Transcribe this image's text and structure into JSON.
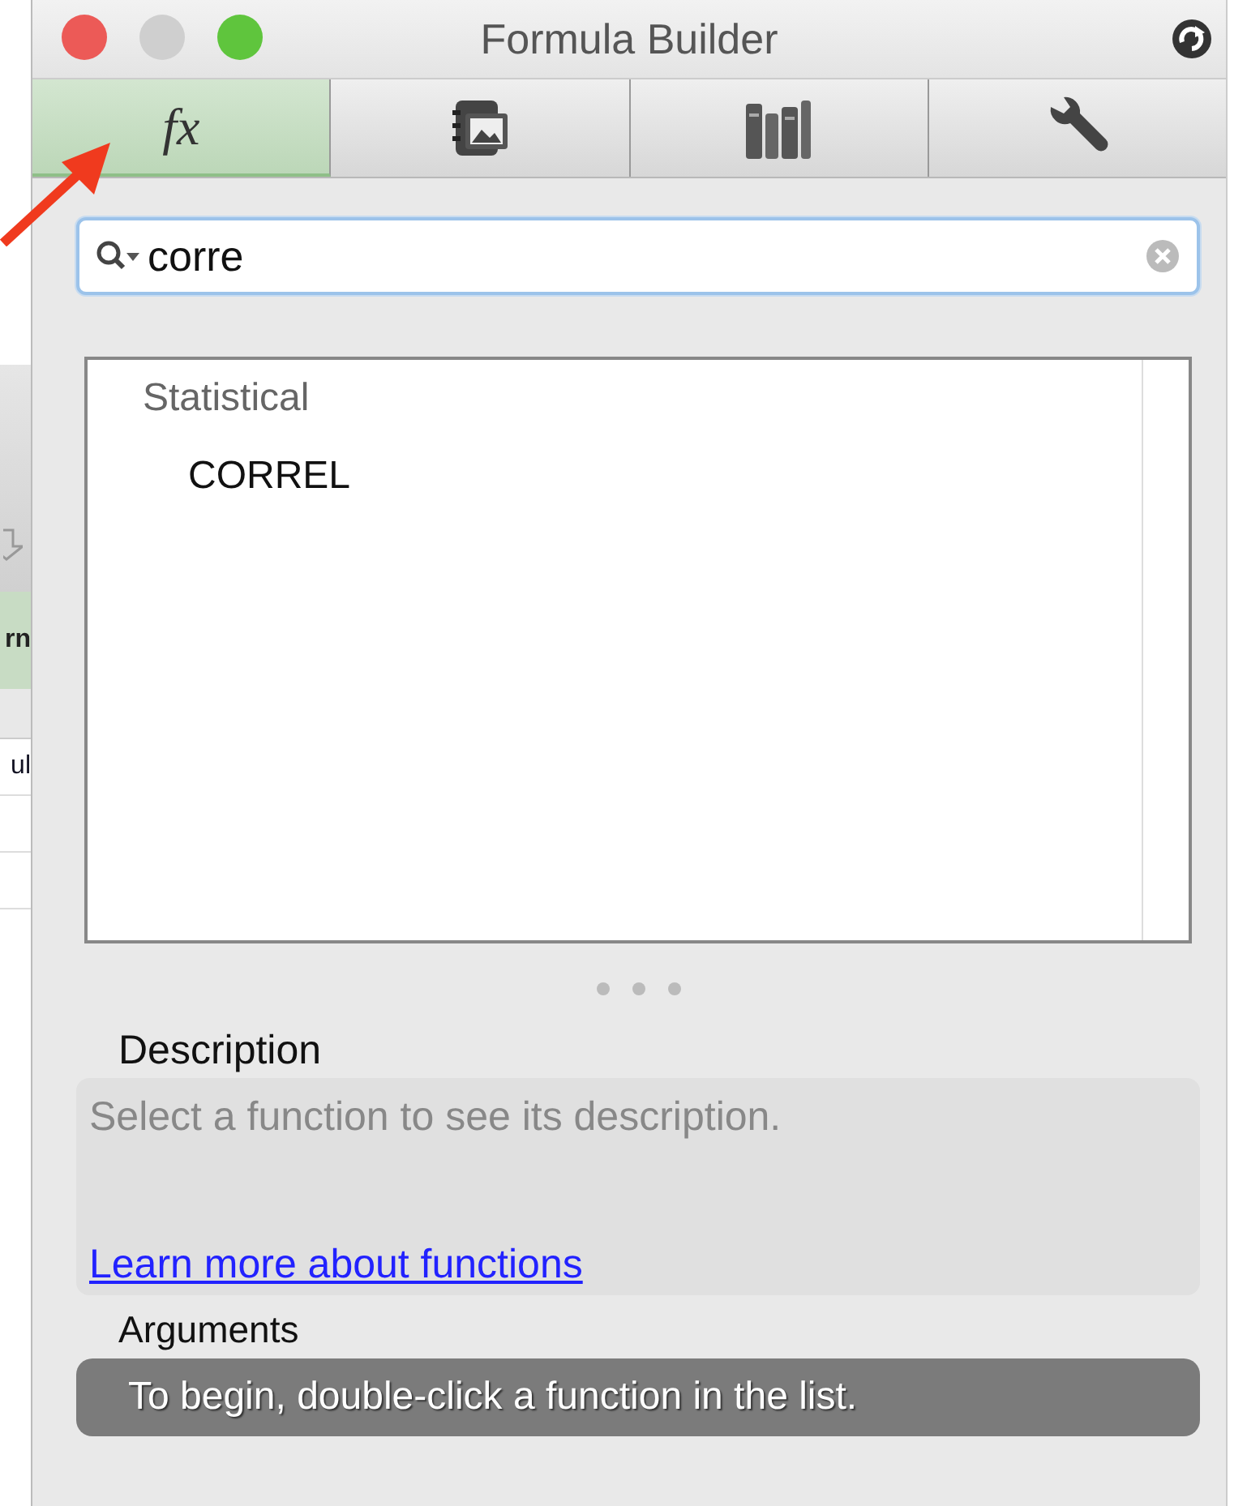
{
  "window": {
    "title": "Formula Builder"
  },
  "tabs": [
    {
      "kind": "function",
      "label": "fx",
      "selected": true
    },
    {
      "kind": "media",
      "selected": false
    },
    {
      "kind": "library",
      "selected": false
    },
    {
      "kind": "tools",
      "selected": false
    }
  ],
  "search": {
    "value": "corre"
  },
  "results": [
    {
      "label": "Statistical",
      "children": [
        {
          "label": "CORREL"
        }
      ]
    }
  ],
  "description": {
    "heading": "Description",
    "text": "Select a function to see its description.",
    "link": "Learn more about functions"
  },
  "arguments": {
    "heading": "Arguments",
    "hint": "To begin, double-click a function in the list."
  },
  "background": {
    "fragments": [
      "rn",
      "ul"
    ]
  }
}
